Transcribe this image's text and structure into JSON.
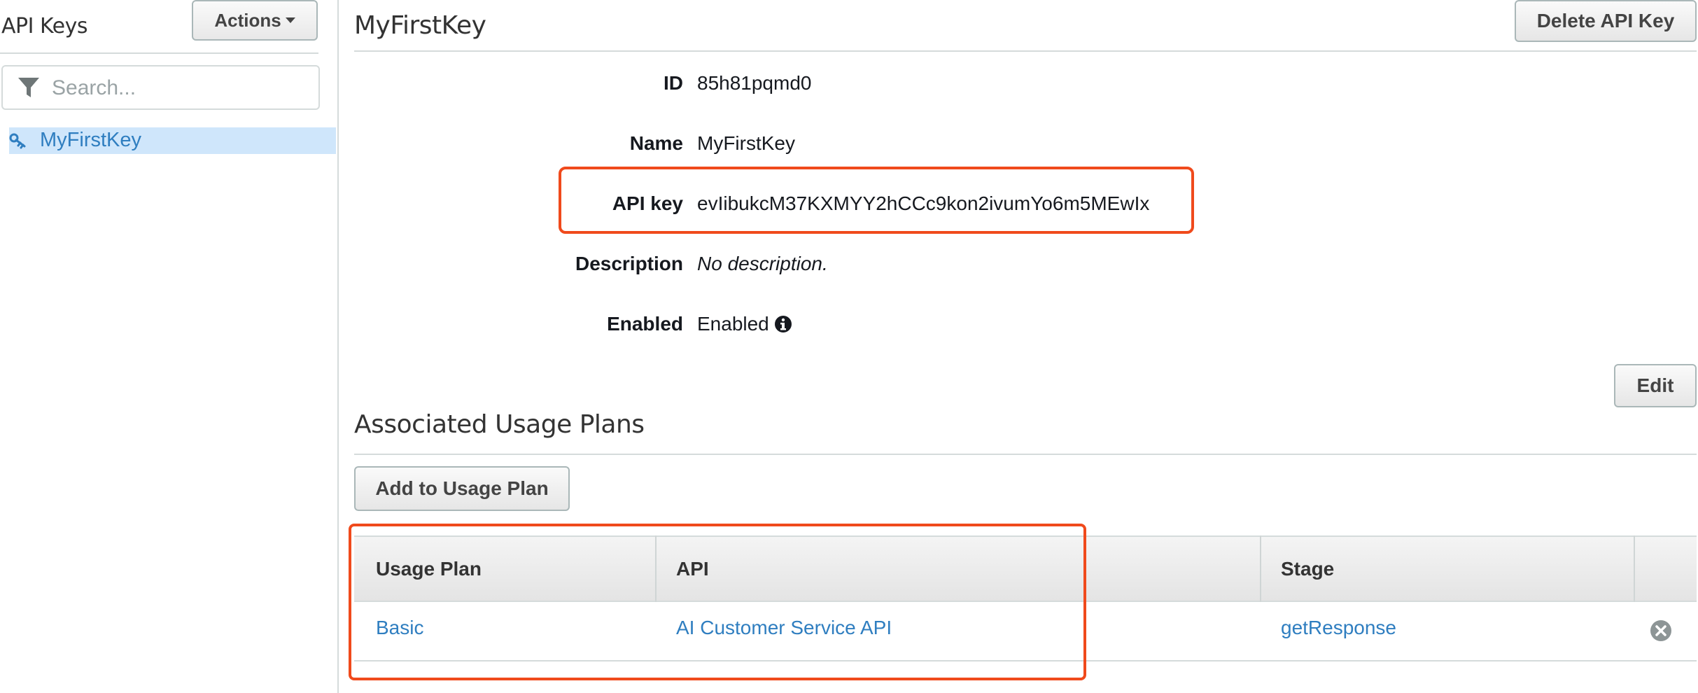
{
  "sidebar": {
    "title": "API Keys",
    "actions_label": "Actions",
    "search_placeholder": "Search...",
    "items": [
      {
        "label": "MyFirstKey",
        "selected": true,
        "icon": "key-icon"
      }
    ]
  },
  "main": {
    "title": "MyFirstKey",
    "delete_label": "Delete API Key",
    "fields": {
      "id": {
        "label": "ID",
        "value": "85h81pqmd0"
      },
      "name": {
        "label": "Name",
        "value": "MyFirstKey"
      },
      "api_key": {
        "label": "API key",
        "value": "evIibukcM37KXMYY2hCCc9kon2ivumYo6m5MEwIx"
      },
      "description": {
        "label": "Description",
        "value": "No description."
      },
      "enabled": {
        "label": "Enabled",
        "value": "Enabled",
        "icon": "info-icon"
      }
    },
    "edit_label": "Edit",
    "plans": {
      "title": "Associated Usage Plans",
      "add_label": "Add to Usage Plan",
      "columns": [
        "Usage Plan",
        "API",
        "Stage"
      ],
      "rows": [
        {
          "usage_plan": "Basic",
          "api": "AI Customer Service API",
          "stage": "getResponse",
          "remove_icon": "remove-circle-icon"
        }
      ]
    }
  },
  "colors": {
    "highlight": "#f04a1c",
    "link": "#2f7ec0",
    "selected_bg": "#cfe6fb"
  }
}
